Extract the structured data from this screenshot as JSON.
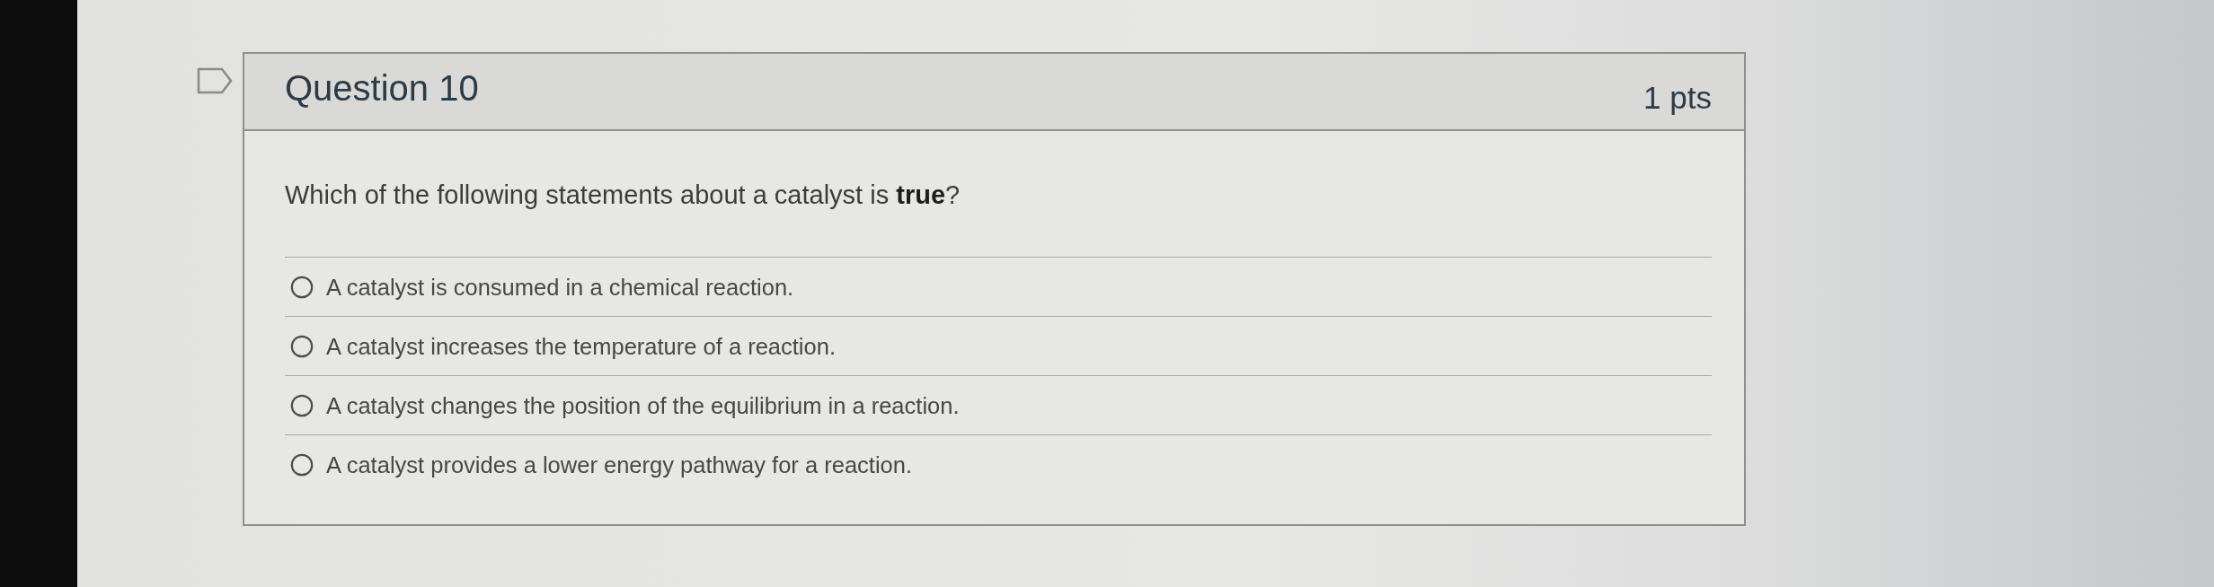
{
  "question": {
    "flagged": false,
    "title": "Question 10",
    "points": "1 pts"
  },
  "prompt": "Which of the following statements about a catalyst is **true**?",
  "options": [
    {
      "text": "A catalyst is consumed in a chemical reaction.",
      "selected": false
    },
    {
      "text": "A catalyst increases the temperature of a reaction.",
      "selected": false
    },
    {
      "text": "A catalyst changes the position of the equilibrium in a reaction.",
      "selected": false
    },
    {
      "text": "A catalyst provides a lower energy pathway for a reaction.",
      "selected": false
    }
  ]
}
